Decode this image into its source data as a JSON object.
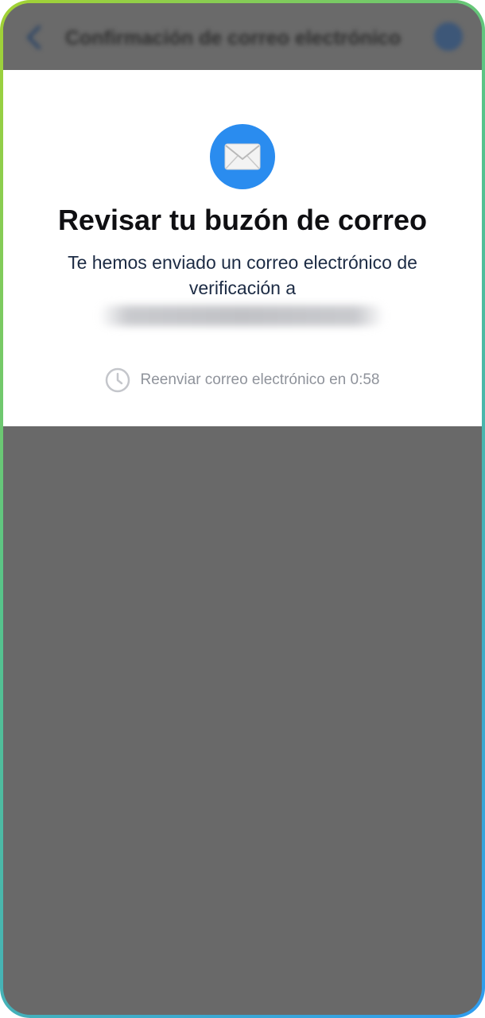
{
  "nav": {
    "title": "Confirmación de correo electrónico",
    "back_icon": "chevron-left-icon",
    "help_icon": "help-icon"
  },
  "sheet": {
    "icon": "envelope-icon",
    "title": "Revisar tu buzón de correo",
    "subtitle_line1": "Te hemos enviado un correo electrónico de",
    "subtitle_line2": "verificación a",
    "resend_text": "Reenviar correo electrónico en 0:58",
    "resend_icon": "clock-icon"
  },
  "colors": {
    "accent": "#2a8cef",
    "overlay": "#696969",
    "text_primary": "#0f0f12",
    "text_muted": "#8f939b"
  }
}
